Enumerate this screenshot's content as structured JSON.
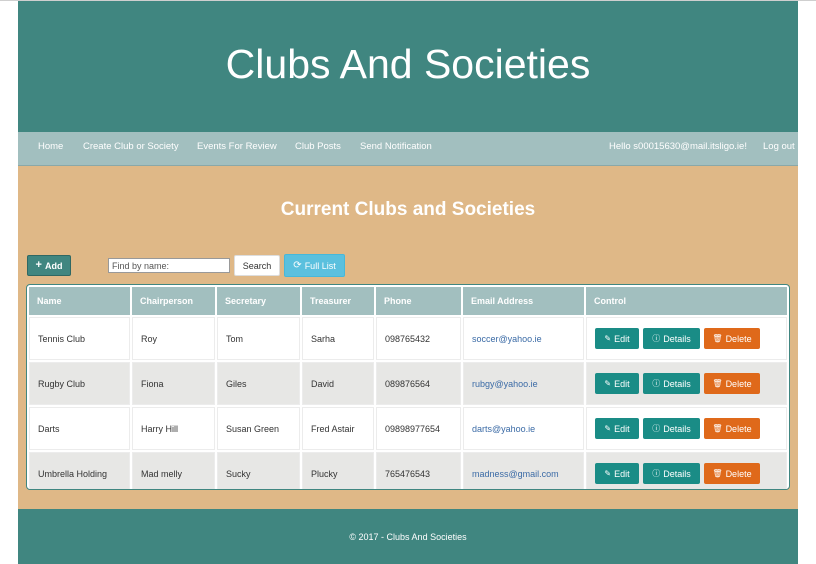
{
  "header": {
    "title": "Clubs And Societies"
  },
  "nav": {
    "items": [
      {
        "label": "Home"
      },
      {
        "label": "Create Club or Society"
      },
      {
        "label": "Events For Review"
      },
      {
        "label": "Club Posts"
      },
      {
        "label": "Send Notification"
      }
    ],
    "greeting": "Hello s00015630@mail.itsligo.ie!",
    "logout": "Log out"
  },
  "main": {
    "heading": "Current Clubs and Societies",
    "add_label": "Add",
    "search_placeholder": "Find by name:",
    "search_label": "Search",
    "full_list_label": "Full List"
  },
  "table": {
    "headers": [
      "Name",
      "Chairperson",
      "Secretary",
      "Treasurer",
      "Phone",
      "Email Address",
      "Control"
    ],
    "rows": [
      {
        "name": "Tennis Club",
        "chair": "Roy",
        "secretary": "Tom",
        "treasurer": "Sarha",
        "phone": "098765432",
        "email": "soccer@yahoo.ie"
      },
      {
        "name": "Rugby Club",
        "chair": "Fiona",
        "secretary": "Giles",
        "treasurer": "David",
        "phone": "089876564",
        "email": "rubgy@yahoo.ie"
      },
      {
        "name": "Darts",
        "chair": "Harry Hill",
        "secretary": "Susan Green",
        "treasurer": "Fred Astair",
        "phone": "09898977654",
        "email": "darts@yahoo.ie"
      },
      {
        "name": "Umbrella Holding",
        "chair": "Mad melly",
        "secretary": "Sucky",
        "treasurer": "Plucky",
        "phone": "765476543",
        "email": "madness@gmail.com"
      }
    ],
    "edit_label": "Edit",
    "details_label": "Details",
    "delete_label": "Delete"
  },
  "footer": {
    "text": "© 2017 - Clubs And Societies"
  },
  "colors": {
    "header": "#408680",
    "nav": "#a2bfbf",
    "main": "#dfb887",
    "delete": "#df691a",
    "action": "#1a8c86"
  }
}
